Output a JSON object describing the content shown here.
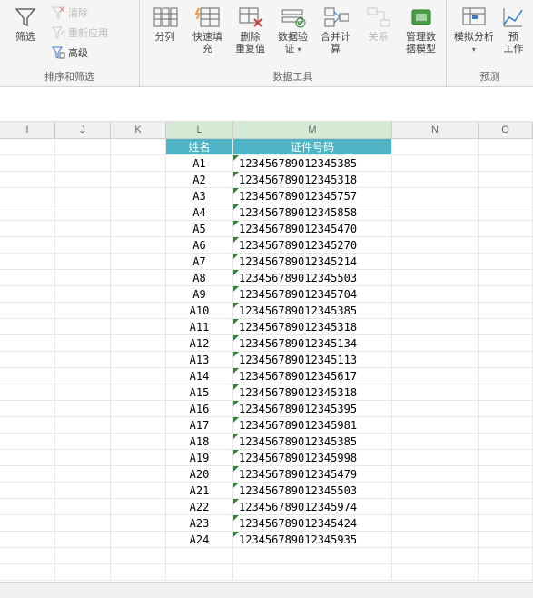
{
  "ribbon": {
    "groups": [
      {
        "label": "排序和筛选",
        "items": {
          "filter": "筛选",
          "clear": "清除",
          "reapply": "重新应用",
          "advanced": "高级"
        }
      },
      {
        "label": "数据工具",
        "items": {
          "text_to_cols": "分列",
          "flash_fill": "快速填充",
          "remove_dup_l1": "删除",
          "remove_dup_l2": "重复值",
          "data_val_l1": "数据验",
          "data_val_l2": "证",
          "consolidate": "合并计算",
          "relations": "关系",
          "manage_l1": "管理数",
          "manage_l2": "据模型"
        }
      },
      {
        "label": "预测",
        "items": {
          "whatif": "模拟分析",
          "forecast_l1": "预",
          "forecast_l2": "工作"
        }
      }
    ]
  },
  "columns": [
    "I",
    "J",
    "K",
    "L",
    "M",
    "N",
    "O"
  ],
  "tableHeader": {
    "name": "姓名",
    "id": "证件号码"
  },
  "rows": [
    {
      "name": "A1",
      "id": "123456789012345385"
    },
    {
      "name": "A2",
      "id": "123456789012345318"
    },
    {
      "name": "A3",
      "id": "123456789012345757"
    },
    {
      "name": "A4",
      "id": "123456789012345858"
    },
    {
      "name": "A5",
      "id": "123456789012345470"
    },
    {
      "name": "A6",
      "id": "123456789012345270"
    },
    {
      "name": "A7",
      "id": "123456789012345214"
    },
    {
      "name": "A8",
      "id": "123456789012345503"
    },
    {
      "name": "A9",
      "id": "123456789012345704"
    },
    {
      "name": "A10",
      "id": "123456789012345385"
    },
    {
      "name": "A11",
      "id": "123456789012345318"
    },
    {
      "name": "A12",
      "id": "123456789012345134"
    },
    {
      "name": "A13",
      "id": "123456789012345113"
    },
    {
      "name": "A14",
      "id": "123456789012345617"
    },
    {
      "name": "A15",
      "id": "123456789012345318"
    },
    {
      "name": "A16",
      "id": "123456789012345395"
    },
    {
      "name": "A17",
      "id": "123456789012345981"
    },
    {
      "name": "A18",
      "id": "123456789012345385"
    },
    {
      "name": "A19",
      "id": "123456789012345998"
    },
    {
      "name": "A20",
      "id": "123456789012345479"
    },
    {
      "name": "A21",
      "id": "123456789012345503"
    },
    {
      "name": "A22",
      "id": "123456789012345974"
    },
    {
      "name": "A23",
      "id": "123456789012345424"
    },
    {
      "name": "A24",
      "id": "123456789012345935"
    }
  ]
}
